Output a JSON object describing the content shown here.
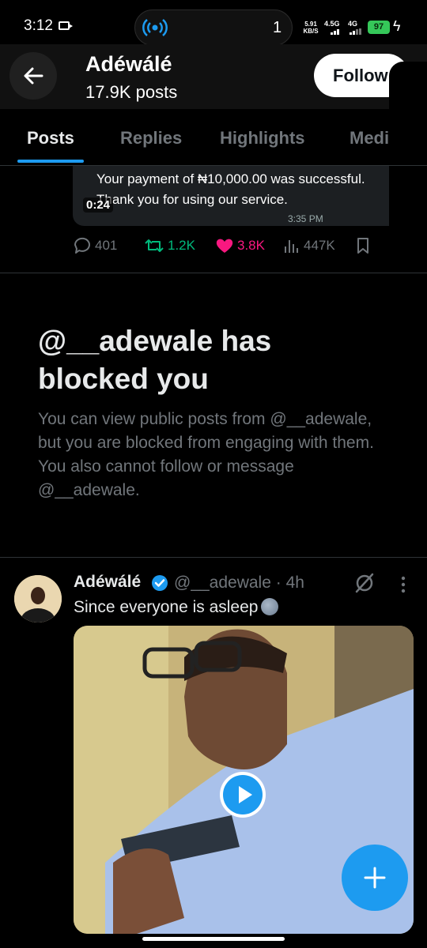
{
  "status_bar": {
    "time": "3:12",
    "notification_count": "1",
    "net_speed": "5.91",
    "net_unit": "KB/S",
    "network_1": "4.5G",
    "network_2": "4G",
    "battery": "97"
  },
  "header": {
    "name": "Adéwálé",
    "posts": "17.9K posts",
    "follow_label": "Follow"
  },
  "tabs": [
    "Posts",
    "Replies",
    "Highlights",
    "Medi"
  ],
  "active_tab": 0,
  "previous_tweet": {
    "receipt_text": "Your payment of ₦10,000.00 was successful. Thank you for using our service.",
    "receipt_time": "3:35 PM",
    "video_duration": "0:24",
    "replies": "401",
    "reposts": "1.2K",
    "likes": "3.8K",
    "views": "447K"
  },
  "blocked_notice": {
    "title": "@__adewale has blocked you",
    "description": "You can view public posts from @__adewale, but you are blocked from engaging with them. You also cannot follow or message @__adewale."
  },
  "tweet": {
    "name": "Adéwálé",
    "handle_time": "@__adewale · 4h",
    "text": "Since everyone is asleep"
  },
  "colors": {
    "accent": "#1d9bf0",
    "repost": "#00ba7c",
    "like": "#f91880",
    "muted": "#71767b"
  }
}
